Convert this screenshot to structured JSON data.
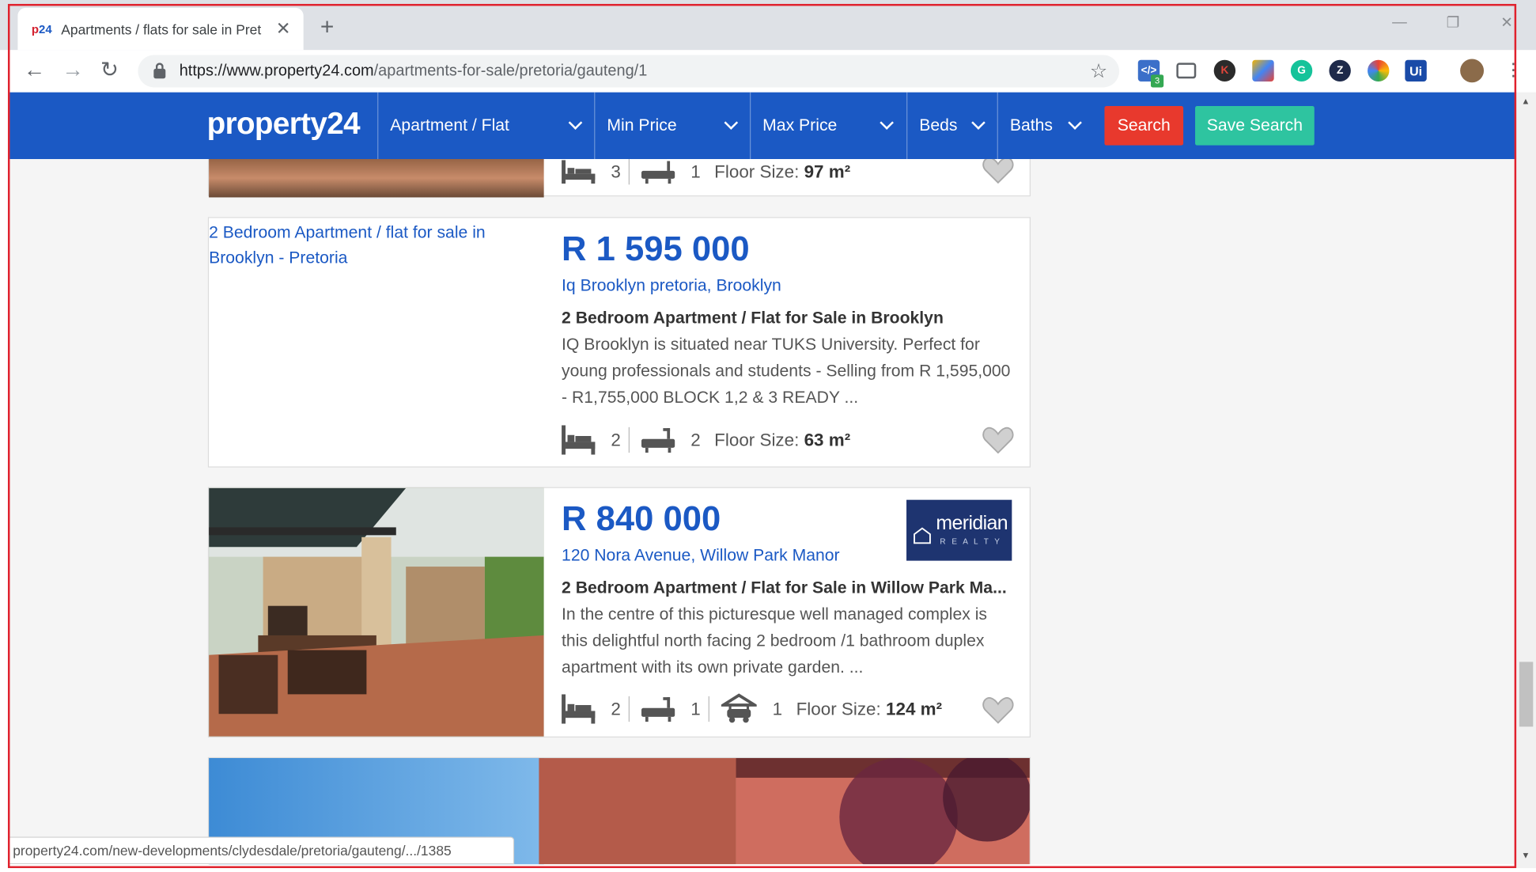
{
  "browser": {
    "tab_favicon_text_red": "p",
    "tab_favicon_text_blue": "24",
    "tab_title": "Apartments / flats for sale in Pret",
    "new_tab": "+",
    "tab_close": "✕",
    "url_host": "https://www.property24.com",
    "url_path": "/apartments-for-sale/pretoria/gauteng/1",
    "extension_badge": "3",
    "status_url": "property24.com/new-developments/clydesdale/pretoria/gauteng/.../1385"
  },
  "header": {
    "logo": "property24",
    "filters": [
      {
        "label": "Apartment / Flat"
      },
      {
        "label": "Min Price"
      },
      {
        "label": "Max Price"
      },
      {
        "label": "Beds"
      },
      {
        "label": "Baths"
      }
    ],
    "search_label": "Search",
    "save_search_label": "Save Search",
    "colors": {
      "brand": "#1b59c4",
      "search": "#e8392d",
      "save": "#2ec4a0"
    }
  },
  "listings": [
    {
      "beds": "3",
      "baths": "1",
      "floor_label": "Floor Size:",
      "floor_size": "97 m²"
    },
    {
      "image_alt": "2 Bedroom Apartment / flat for sale in Brooklyn - Pretoria",
      "price": "R 1 595 000",
      "location": "Iq Brooklyn pretoria, Brooklyn",
      "title": "2 Bedroom Apartment / Flat for Sale in Brooklyn",
      "description": "IQ Brooklyn is situated near TUKS University. Perfect for young professionals and students - Selling from R 1,595,000 - R1,755,000 BLOCK 1,2 & 3 READY ...",
      "beds": "2",
      "baths": "2",
      "floor_label": "Floor Size:",
      "floor_size": "63 m²"
    },
    {
      "price": "R 840 000",
      "location": "120 Nora Avenue, Willow Park Manor",
      "title": "2 Bedroom Apartment / Flat for Sale in Willow Park Ma...",
      "description": "In the centre of this picturesque well managed complex is this delightful north facing 2 bedroom /1 bathroom duplex apartment with its own private garden. ...",
      "beds": "2",
      "baths": "1",
      "parking": "1",
      "floor_label": "Floor Size:",
      "floor_size": "124 m²",
      "agency_logo": "meridian",
      "agency_sub": "R E A L T Y"
    }
  ]
}
